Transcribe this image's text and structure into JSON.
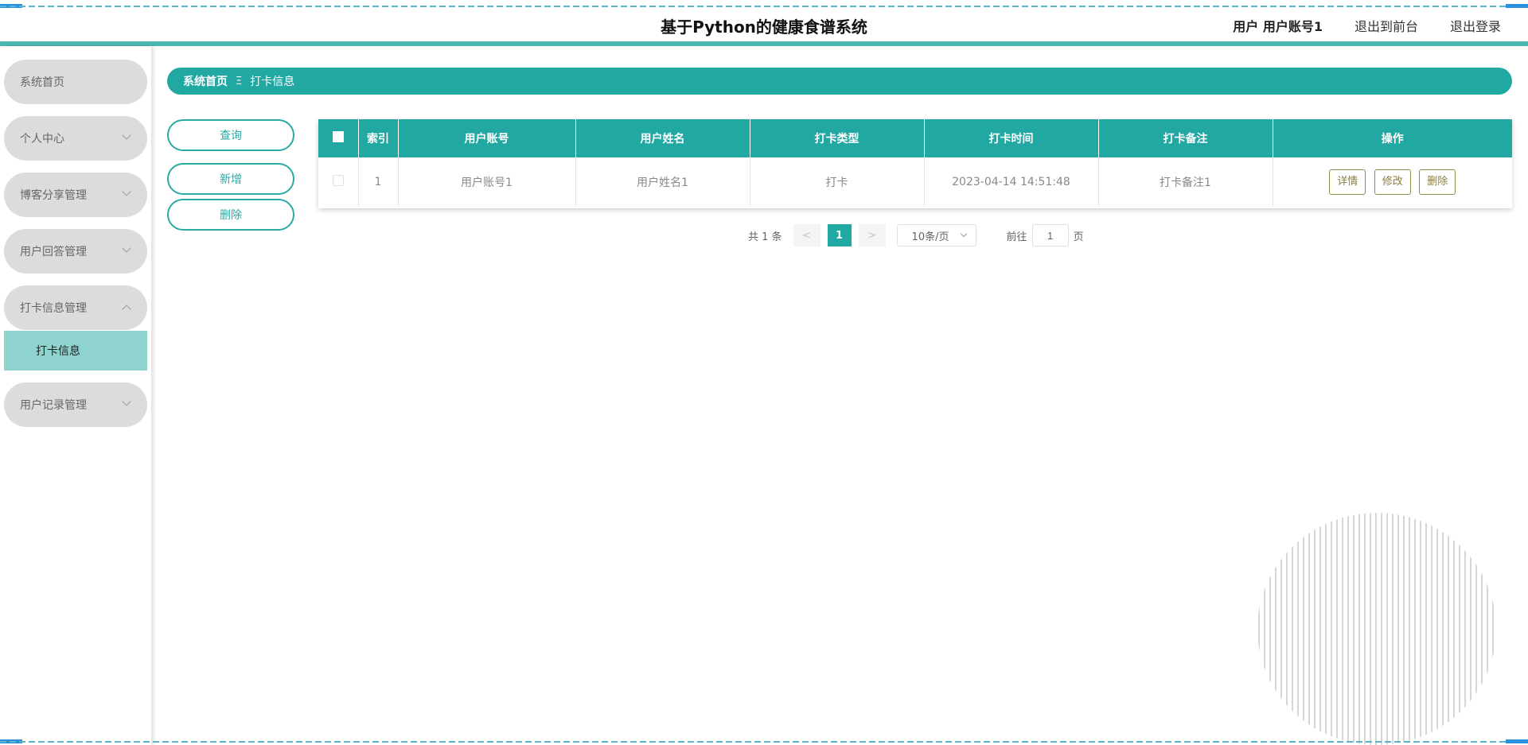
{
  "header": {
    "title": "基于Python的健康食谱系统",
    "user_prefix": "用户",
    "user_name": "用户账号1",
    "back_to_front": "退出到前台",
    "logout": "退出登录"
  },
  "sidebar": {
    "items": [
      {
        "label": "系统首页"
      },
      {
        "label": "个人中心"
      },
      {
        "label": "博客分享管理"
      },
      {
        "label": "用户回答管理"
      },
      {
        "label": "打卡信息管理"
      },
      {
        "label": "用户记录管理"
      }
    ],
    "active_sub": "打卡信息"
  },
  "breadcrumb": {
    "home": "系统首页",
    "separator": "Ξ",
    "current": "打卡信息"
  },
  "actions": {
    "query": "查询",
    "add": "新增",
    "delete": "删除"
  },
  "table": {
    "columns": [
      "索引",
      "用户账号",
      "用户姓名",
      "打卡类型",
      "打卡时间",
      "打卡备注",
      "操作"
    ],
    "rows": [
      {
        "index": "1",
        "account": "用户账号1",
        "name": "用户姓名1",
        "type": "打卡",
        "time": "2023-04-14 14:51:48",
        "note": "打卡备注1"
      }
    ],
    "ops": {
      "detail": "详情",
      "edit": "修改",
      "delete": "删除"
    }
  },
  "pagination": {
    "total": "共 1 条",
    "prev": "<",
    "current_page": "1",
    "next": ">",
    "page_size": "10条/页",
    "goto_label": "前往",
    "goto_value": "1",
    "page_suffix": "页"
  },
  "colors": {
    "accent": "#21a8a3",
    "sidebar_item": "#dcdcdc",
    "active_sub": "#8fd3cf"
  }
}
